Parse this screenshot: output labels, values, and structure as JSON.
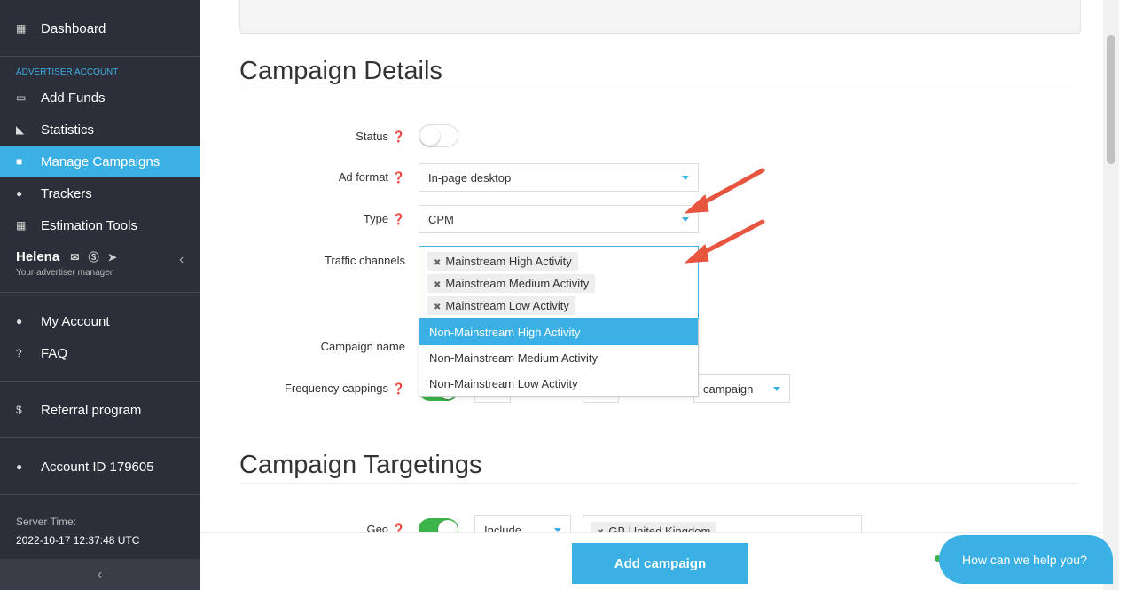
{
  "sidebar": {
    "dashboard": "Dashboard",
    "section": "ADVERTISER ACCOUNT",
    "items": [
      {
        "label": "Add Funds",
        "icon": "credit-card-icon"
      },
      {
        "label": "Statistics",
        "icon": "area-chart-icon"
      },
      {
        "label": "Manage Campaigns",
        "icon": "briefcase-icon",
        "active": true
      },
      {
        "label": "Trackers",
        "icon": "users-icon"
      },
      {
        "label": "Estimation Tools",
        "icon": "calculator-icon"
      }
    ],
    "manager": {
      "name": "Helena",
      "subtitle": "Your advertiser manager"
    },
    "my_account": "My Account",
    "faq": "FAQ",
    "referral": "Referral program",
    "account_id": "Account ID 179605",
    "server_time_label": "Server Time:",
    "server_time": "2022-10-17 12:37:48 UTC"
  },
  "details": {
    "title": "Campaign Details",
    "status_label": "Status",
    "status_on": false,
    "ad_format_label": "Ad format",
    "ad_format": "In-page desktop",
    "type_label": "Type",
    "type": "CPM",
    "traffic_label": "Traffic channels",
    "traffic_selected": [
      "Mainstream High Activity",
      "Mainstream Medium Activity",
      "Mainstream Low Activity"
    ],
    "traffic_options": [
      "Non-Mainstream High Activity",
      "Non-Mainstream Medium Activity",
      "Non-Mainstream Low Activity"
    ],
    "campaign_name_label": "Campaign name",
    "frequency_label": "Frequency cappings",
    "frequency_period": "campaign"
  },
  "targetings": {
    "title": "Campaign Targetings",
    "geo_label": "Geo",
    "geo_mode": "Include",
    "geo_tag": "GB United Kingdom"
  },
  "footer": {
    "add_campaign": "Add campaign"
  },
  "chat": {
    "label": "How can we help you?"
  },
  "colors": {
    "accent": "#3bb0e4",
    "sidebar": "#2c2e39",
    "toggle_on": "#3cb44a",
    "arrow": "#e8553f"
  }
}
